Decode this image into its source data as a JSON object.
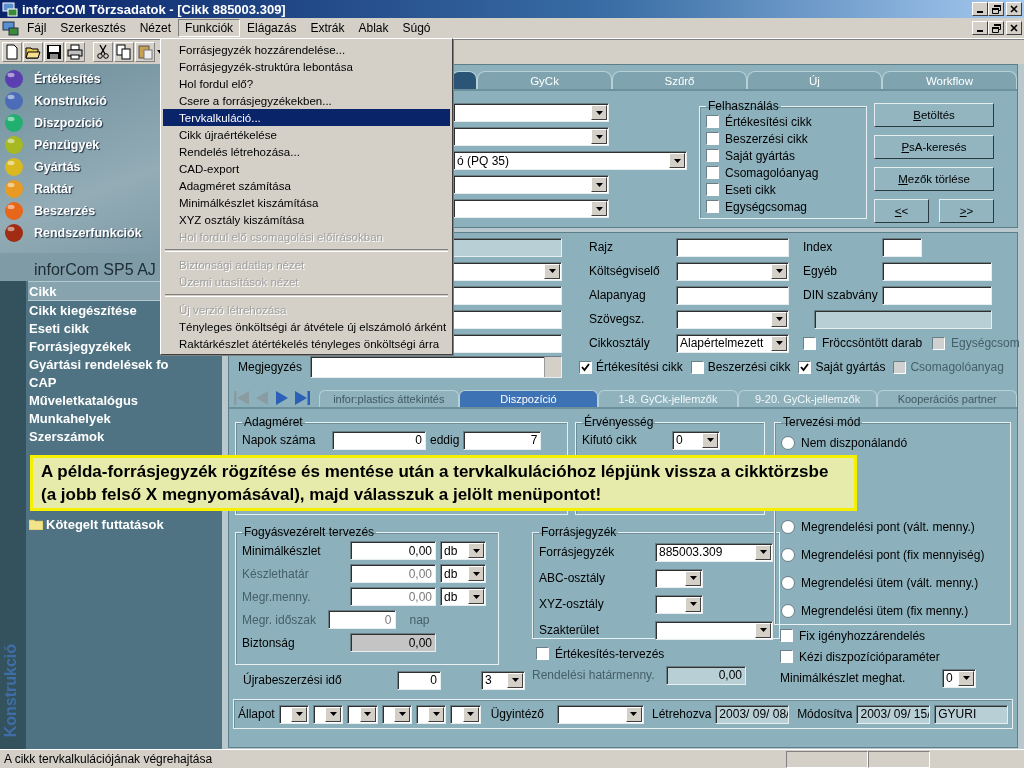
{
  "window": {
    "title": "infor:COM Törzsadatok - [Cikk 885003.309]"
  },
  "menu_bar": [
    {
      "label": "Fájl",
      "selected": false
    },
    {
      "label": "Szerkesztés",
      "selected": false
    },
    {
      "label": "Nézet",
      "selected": false
    },
    {
      "label": "Funkciók",
      "selected": true
    },
    {
      "label": "Elágazás",
      "selected": false
    },
    {
      "label": "Extrák",
      "selected": false
    },
    {
      "label": "Ablak",
      "selected": false
    },
    {
      "label": "Súgó",
      "selected": false
    }
  ],
  "menu": [
    {
      "kind": "item",
      "label": "Forrásjegyzék hozzárendelése...",
      "disabled": false,
      "selected": false
    },
    {
      "kind": "item",
      "label": "Forrásjegyzék-struktúra lebontása",
      "disabled": false,
      "selected": false
    },
    {
      "kind": "item",
      "label": "Hol fordul elő?",
      "disabled": false,
      "selected": false
    },
    {
      "kind": "item",
      "label": "Csere a forrásjegyzékekben...",
      "disabled": false,
      "selected": false
    },
    {
      "kind": "item",
      "label": "Tervkalkuláció...",
      "disabled": false,
      "selected": true
    },
    {
      "kind": "item",
      "label": "Cikk újraértékelése",
      "disabled": false,
      "selected": false
    },
    {
      "kind": "item",
      "label": "Rendelés létrehozása...",
      "disabled": false,
      "selected": false
    },
    {
      "kind": "item",
      "label": "CAD-export",
      "disabled": false,
      "selected": false
    },
    {
      "kind": "item",
      "label": "Adagméret számítása",
      "disabled": false,
      "selected": false
    },
    {
      "kind": "item",
      "label": "Minimálkészlet kiszámítása",
      "disabled": false,
      "selected": false
    },
    {
      "kind": "item",
      "label": "XYZ osztály kiszámítása",
      "disabled": false,
      "selected": false
    },
    {
      "kind": "item",
      "label": "Hol fordul elő csomagolási előírásokban",
      "disabled": true,
      "selected": false
    },
    {
      "kind": "separator"
    },
    {
      "kind": "item",
      "label": "Biztonsági adatlap nézet",
      "disabled": true,
      "selected": false
    },
    {
      "kind": "item",
      "label": "Üzemi utasítások nézet",
      "disabled": true,
      "selected": false
    },
    {
      "kind": "separator"
    },
    {
      "kind": "item",
      "label": "Új verzió létrehozása",
      "disabled": true,
      "selected": false
    },
    {
      "kind": "item",
      "label": "Tényleges önköltségi ár átvétele új elszámoló árként",
      "disabled": false,
      "selected": false
    },
    {
      "kind": "item",
      "label": "Raktárkészlet átértékelés tényleges önköltségi árra",
      "disabled": false,
      "selected": false
    }
  ],
  "sidebar": {
    "modules": [
      {
        "label": "Értékesítés",
        "color": "#5b3fb0"
      },
      {
        "label": "Konstrukció",
        "color": "#4c6cb8"
      },
      {
        "label": "Diszpozíció",
        "color": "#22b070"
      },
      {
        "label": "Pénzügyek",
        "color": "#a6b822"
      },
      {
        "label": "Gyártás",
        "color": "#d9b820"
      },
      {
        "label": "Raktár",
        "color": "#e99a22"
      },
      {
        "label": "Beszerzés",
        "color": "#e8661a"
      },
      {
        "label": "Rendszerfunkciók",
        "color": "#a02c14"
      }
    ],
    "heading": "inforCom SP5 AJ",
    "items": [
      {
        "kind": "item",
        "label": "Cikk",
        "selected": true
      },
      {
        "kind": "item",
        "label": "Cikk kiegészítése",
        "selected": false
      },
      {
        "kind": "item",
        "label": "Eseti cikk",
        "selected": false
      },
      {
        "kind": "item",
        "label": "Forrásjegyzékek",
        "selected": false
      },
      {
        "kind": "item",
        "label": "Gyártási rendelések fo",
        "selected": false
      },
      {
        "kind": "item",
        "label": "CAP",
        "selected": false
      },
      {
        "kind": "item",
        "label": "Műveletkatalógus",
        "selected": false
      },
      {
        "kind": "item",
        "label": "Munkahelyek",
        "selected": false
      },
      {
        "kind": "item",
        "label": "Szerszámok",
        "selected": false
      },
      {
        "kind": "folder",
        "label": "Kötegelt futtatások",
        "selected": false
      }
    ],
    "vertical_label": "Konstrukció"
  },
  "search_window": {
    "tabs": [
      {
        "selected": true
      },
      {
        "label": "GyCk",
        "selected": false
      },
      {
        "label": "Szűrő",
        "selected": false
      },
      {
        "label": "Új",
        "selected": false
      },
      {
        "label": "Workflow",
        "selected": false
      }
    ],
    "fields": [
      {
        "kind": "dropdown"
      },
      {
        "kind": "dropdown"
      },
      {
        "kind": "dropdown",
        "value": "ó (PQ 35)"
      },
      {
        "kind": "dropdown"
      },
      {
        "kind": "dropdown"
      }
    ],
    "usage": {
      "title": "Felhasználás",
      "options": [
        {
          "label": "Értékesítési cikk",
          "checked": false
        },
        {
          "label": "Beszerzési cikk",
          "checked": false
        },
        {
          "label": "Saját gyártás",
          "checked": false
        },
        {
          "label": "Csomagolóanyag",
          "checked": false
        },
        {
          "label": "Eseti cikk",
          "checked": false
        },
        {
          "label": "Egységcsomag",
          "checked": false
        }
      ]
    },
    "buttons": [
      "Betöltés",
      "PsA-keresés",
      "Mezők törlése"
    ],
    "nav_buttons": [
      "<<",
      ">>"
    ]
  },
  "item_window": {
    "col1": [
      {
        "kind": "readonly"
      },
      {
        "kind": "dropdown"
      },
      {
        "kind": "text"
      },
      {
        "kind": "text"
      },
      {
        "kind": "text"
      }
    ],
    "col2": [
      {
        "label": "Rajz",
        "kind": "text"
      },
      {
        "label": "Költségviselő",
        "kind": "dropdown"
      },
      {
        "label": "Alapanyag",
        "kind": "text"
      },
      {
        "label": "Szövegsz.",
        "kind": "dropdown"
      },
      {
        "label": "Cikkosztály",
        "kind": "dropdown",
        "value": "Alapértelmezett"
      }
    ],
    "col3": [
      {
        "label": "Index",
        "kind": "short"
      },
      {
        "label": "Egyéb",
        "kind": "text"
      },
      {
        "label": "DIN szabvány",
        "kind": "text"
      }
    ],
    "note_label": "Megjegyzés",
    "flags_right": [
      {
        "label": "Fröccsöntött darab",
        "checked": false,
        "disabled": false
      },
      {
        "label": "Egységcsom",
        "checked": false,
        "disabled": true
      }
    ],
    "flags": [
      {
        "label": "Értékesítési cikk",
        "checked": true,
        "disabled": false
      },
      {
        "label": "Beszerzési cikk",
        "checked": false,
        "disabled": false
      },
      {
        "label": "Saját gyártás",
        "checked": true,
        "disabled": false
      },
      {
        "label": "Csomagolóanyag",
        "checked": false,
        "disabled": true
      }
    ],
    "nav": [
      {
        "kind": "first",
        "disabled": true
      },
      {
        "kind": "prev",
        "disabled": true
      },
      {
        "kind": "next",
        "disabled": false
      },
      {
        "kind": "last",
        "disabled": false
      }
    ],
    "tabs": [
      {
        "label": "infor:plastics áttekintés",
        "selected": false,
        "disabled": true
      },
      {
        "label": "Diszpozíció",
        "selected": true,
        "disabled": false
      },
      {
        "label": "1-8. GyCk-jellemzők",
        "selected": false,
        "disabled": false
      },
      {
        "label": "9-20. GyCk-jellemzők",
        "selected": false,
        "disabled": false
      },
      {
        "label": "Kooperációs partner",
        "selected": false,
        "disabled": true
      }
    ],
    "batch_size": {
      "title": "Adagméret",
      "label": "Napok száma",
      "from": "0",
      "to_label": "eddig",
      "to": "7"
    },
    "validity": {
      "title": "Érvényesség",
      "label": "Kifutó cikk",
      "value": "0"
    },
    "planning_mode": {
      "title": "Tervezési mód",
      "options": [
        {
          "label": "Nem diszponálandó",
          "selected": false
        },
        {
          "label": "Megrendelési pont (vált. menny.)",
          "selected": false
        },
        {
          "label": "Megrendelési pont (fix mennyiség)",
          "selected": false
        },
        {
          "label": "Megrendelési ütem (vált. menny.)",
          "selected": false
        },
        {
          "label": "Megrendelési ütem (fix menny.)",
          "selected": false
        }
      ]
    },
    "consumption": {
      "title": "Fogyásvezérelt tervezés",
      "rows": [
        {
          "kind": "unit_dropdown",
          "label": "Minimálkészlet",
          "value": "0,00",
          "unit": "db",
          "disabled": false
        },
        {
          "kind": "unit_dropdown",
          "label": "Készlethatár",
          "value": "0,00",
          "unit": "db",
          "disabled": true
        },
        {
          "kind": "unit_dropdown",
          "label": "Megr.menny.",
          "value": "0,00",
          "unit": "db",
          "disabled": true
        },
        {
          "kind": "unit_text",
          "label": "Megr. időszak",
          "value": "0",
          "unit": "nap",
          "disabled": true
        },
        {
          "kind": "readonly",
          "label": "Biztonság",
          "value": "0,00",
          "disabled": false
        }
      ]
    },
    "replenishment": {
      "label": "Újrabeszerzési idő",
      "value": "0",
      "unit": "3"
    },
    "bom": {
      "title": "Forrásjegyzék",
      "rows": [
        {
          "kind": "wide",
          "label": "Forrásjegyzék",
          "value": "885003.309"
        },
        {
          "kind": "short",
          "label": "ABC-osztály"
        },
        {
          "kind": "short",
          "label": "XYZ-osztály"
        },
        {
          "kind": "wide",
          "label": "Szakterület"
        }
      ]
    },
    "sales_planning": {
      "label": "Értékesítés-tervezés",
      "checked": false
    },
    "order_limit": {
      "label": "Rendelési határmenny.",
      "value": "0,00",
      "disabled": true
    },
    "right_flags": [
      {
        "label": "Fix igényhozzárendelés",
        "checked": false
      },
      {
        "label": "Kézi diszpozícióparaméter",
        "checked": false
      }
    ],
    "min_stock_method": {
      "label": "Minimálkészlet meghat.",
      "value": "0"
    },
    "footer": {
      "status_label": "Állapot",
      "status_fields": [
        {
          "kind": "dropdown"
        },
        {
          "kind": "dropdown"
        },
        {
          "kind": "dropdown"
        },
        {
          "kind": "dropdown"
        },
        {
          "kind": "dropdown"
        },
        {
          "kind": "dropdown"
        }
      ],
      "clerk_label": "Ügyintéző",
      "created_label": "Létrehozva",
      "created": "2003/ 09/ 08/",
      "modified_label": "Módosítva",
      "modified": "2003/ 09/ 15/",
      "user": "GYURI"
    }
  },
  "callout": "A példa-forrásjegyzék rögzítése és mentése után a tervkalkulációhoz lépjünk vissza a cikktörzsbe (a jobb felső X megnyomásával), majd válasszuk a jelölt menüpontot!",
  "status_bar": {
    "text": "A cikk tervkalkulációjának végrehajtása"
  }
}
